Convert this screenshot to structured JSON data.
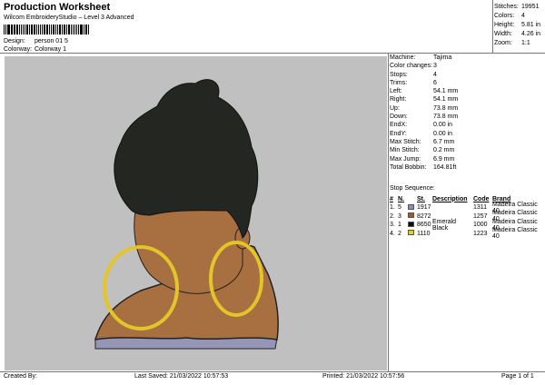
{
  "header": {
    "title": "Production Worksheet",
    "subtitle": "Wilcom EmbroideryStudio – Level 3 Advanced"
  },
  "meta": {
    "design_label": "Design:",
    "design_value": "person 01 5",
    "colorway_label": "Colorway:",
    "colorway_value": "Colorway 1"
  },
  "top_stats": [
    {
      "label": "Stitches:",
      "value": "19951"
    },
    {
      "label": "Colors:",
      "value": "4"
    },
    {
      "label": "Height:",
      "value": "5.81 in"
    },
    {
      "label": "Width:",
      "value": "4.26 in"
    },
    {
      "label": "Zoom:",
      "value": "1:1"
    }
  ],
  "specs": [
    {
      "label": "Machine:",
      "value": "Tajima"
    },
    {
      "label": "Color changes:",
      "value": "3"
    },
    {
      "label": "Stops:",
      "value": "4"
    },
    {
      "label": "Trims:",
      "value": "6"
    },
    {
      "label": "Left:",
      "value": "54.1 mm"
    },
    {
      "label": "Right:",
      "value": "54.1 mm"
    },
    {
      "label": "Up:",
      "value": "73.8 mm"
    },
    {
      "label": "Down:",
      "value": "73.8 mm"
    },
    {
      "label": "EndX:",
      "value": "0.00 in"
    },
    {
      "label": "EndY:",
      "value": "0.00 in"
    },
    {
      "label": "Max Stitch:",
      "value": "6.7 mm"
    },
    {
      "label": "Min Stitch:",
      "value": "0.2 mm"
    },
    {
      "label": "Max Jump:",
      "value": "6.9 mm"
    },
    {
      "label": "Total Bobbin:",
      "value": "164.81ft"
    }
  ],
  "stop_sequence": {
    "title": "Stop Sequence:",
    "headers": [
      "#",
      "N.",
      "St.",
      "Description",
      "Code",
      "Brand"
    ],
    "rows": [
      {
        "idx": "1.",
        "n": "5",
        "color": "#8c8fb8",
        "st": "1917",
        "desc": "",
        "code": "1311",
        "brand": "Madeira Classic 40"
      },
      {
        "idx": "2.",
        "n": "3",
        "color": "#9a5a2e",
        "st": "8272",
        "desc": "",
        "code": "1257",
        "brand": "Madeira Classic 40"
      },
      {
        "idx": "3.",
        "n": "1",
        "color": "#0b0b0b",
        "st": "8650",
        "desc": "Emerald Black",
        "code": "1000",
        "brand": "Madeira Classic 40"
      },
      {
        "idx": "4.",
        "n": "2",
        "color": "#e6cc1e",
        "st": "1110",
        "desc": "",
        "code": "1223",
        "brand": "Madeira Classic 40"
      }
    ]
  },
  "footer": {
    "created_by": "Created By:",
    "last_saved": "Last Saved: 21/03/2022 10:57:53",
    "printed": "Printed: 21/03/2022 10:57:56",
    "page": "Page 1 of 1"
  },
  "colors": {
    "canvas_bg": "#c0c0c0",
    "hair": "#232621",
    "skin": "#a86f40",
    "hoop": "#e3c52a",
    "shirt": "#9596b6"
  }
}
